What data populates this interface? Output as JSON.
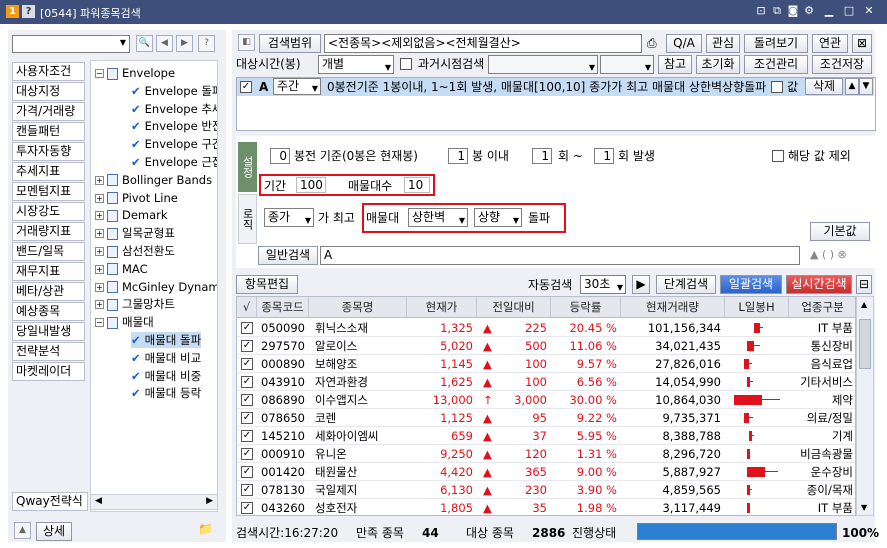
{
  "window": {
    "badge": "1",
    "help": "?",
    "title": "[0544] 파워종목검색"
  },
  "sidebar": {
    "categories": [
      "사용자조건",
      "대상지정",
      "가격/거래량",
      "캔들패턴",
      "투자자동향",
      "추세지표",
      "모멘텀지표",
      "시장강도",
      "거래량지표",
      "밴드/일목",
      "재무지표",
      "베타/상관",
      "예상종목",
      "당일내발생",
      "전략분석",
      "마켓레이더"
    ],
    "qway": "Qway전략식",
    "detail_btn": "상세"
  },
  "tree": [
    {
      "t": "Envelope",
      "type": "folder",
      "open": true
    },
    {
      "t": "Envelope 돌파",
      "type": "item"
    },
    {
      "t": "Envelope 추세",
      "type": "item"
    },
    {
      "t": "Envelope 반전",
      "type": "item"
    },
    {
      "t": "Envelope 구간",
      "type": "item"
    },
    {
      "t": "Envelope 근접",
      "type": "item"
    },
    {
      "t": "Bollinger Bands",
      "type": "folder",
      "open": false
    },
    {
      "t": "Pivot Line",
      "type": "folder",
      "open": false
    },
    {
      "t": "Demark",
      "type": "folder",
      "open": false
    },
    {
      "t": "일목균형표",
      "type": "folder",
      "open": false
    },
    {
      "t": "삼선전환도",
      "type": "folder",
      "open": false
    },
    {
      "t": "MAC",
      "type": "folder",
      "open": false
    },
    {
      "t": "McGinley Dynamic",
      "type": "folder",
      "open": false
    },
    {
      "t": "그물망차트",
      "type": "folder",
      "open": false
    },
    {
      "t": "매물대",
      "type": "folder",
      "open": true
    },
    {
      "t": "매물대 돌파",
      "type": "item",
      "selected": true
    },
    {
      "t": "매물대 비교",
      "type": "item"
    },
    {
      "t": "매물대 비중",
      "type": "item"
    },
    {
      "t": "매물대 등락",
      "type": "item"
    }
  ],
  "top": {
    "range_btn": "검색범위",
    "range_text": "<전종목><제외없음><전체월결산>",
    "qa": "Q/A",
    "fav": "관심",
    "replay": "돌려보기",
    "link": "연관",
    "target_label": "대상시간(봉)",
    "target_value": "개별",
    "past_label": "과거시점검색",
    "ref": "참고",
    "reset": "초기화",
    "manage": "조건관리",
    "save": "조건저장"
  },
  "cond_row": {
    "letter": "A",
    "period": "주간",
    "text": "0봉전기준 1봉이내, 1~1회 발생, 매물대[100,10] 종가가 최고 매물대 상한벽상향돌파",
    "value_label": "값",
    "delete": "삭제"
  },
  "setting": {
    "tab1": "설정",
    "tab2": "로직",
    "bong_value": "0",
    "bong_label": "봉전 기준(0봉은 현재봉)",
    "within_value": "1",
    "within_label": "봉 이내",
    "times_from": "1",
    "times_mid": "회 ~",
    "times_to": "1",
    "times_label": "회 발생",
    "exclude_label": "해당 값 제외",
    "period_label": "기간",
    "period_value": "100",
    "count_label": "매물대수",
    "count_value": "10",
    "price_sel": "종가",
    "max_label": "가 최고",
    "mulmul_label": "매물대",
    "wall_sel": "상한벽",
    "dir_sel": "상향",
    "breakout": "돌파",
    "default_btn": "기본값",
    "general_btn": "일반검색",
    "general_text": "A"
  },
  "toolbar": {
    "edit": "항목편집",
    "auto_label": "자동검색",
    "auto_value": "30초",
    "step": "단계검색",
    "bulk": "일괄검색",
    "realtime": "실시간검색"
  },
  "columns": [
    "√",
    "종목코드",
    "종목명",
    "현재가",
    "전일대비",
    "등락률",
    "현재거래량",
    "L일봉H",
    "업종구분"
  ],
  "rows": [
    {
      "code": "050090",
      "name": "휘닉스소재",
      "price": "1,325",
      "arrow": "▲",
      "chg": "225",
      "rate": "20.45 %",
      "vol": "101,156,344",
      "bar": [
        0.45,
        0.62
      ],
      "sector": "IT 부품"
    },
    {
      "code": "297570",
      "name": "알로이스",
      "price": "5,020",
      "arrow": "▲",
      "chg": "500",
      "rate": "11.06 %",
      "vol": "34,021,435",
      "bar": [
        0.3,
        0.55
      ],
      "sector": "통신장비"
    },
    {
      "code": "000890",
      "name": "보해양조",
      "price": "1,145",
      "arrow": "▲",
      "chg": "100",
      "rate": "9.57 %",
      "vol": "27,826,016",
      "bar": [
        0.25,
        0.4
      ],
      "sector": "음식료업"
    },
    {
      "code": "043910",
      "name": "자연과환경",
      "price": "1,625",
      "arrow": "▲",
      "chg": "100",
      "rate": "6.56 %",
      "vol": "14,054,990",
      "bar": [
        0.3,
        0.42
      ],
      "sector": "기타서비스"
    },
    {
      "code": "086890",
      "name": "이수앱지스",
      "price": "13,000",
      "arrow": "↑",
      "chg": "3,000",
      "rate": "30.00 %",
      "vol": "10,864,030",
      "bar": [
        0.05,
        0.95
      ],
      "sector": "제약"
    },
    {
      "code": "078650",
      "name": "코렌",
      "price": "1,125",
      "arrow": "▲",
      "chg": "95",
      "rate": "9.22 %",
      "vol": "9,735,371",
      "bar": [
        0.25,
        0.42
      ],
      "sector": "의료/정밀"
    },
    {
      "code": "145210",
      "name": "세화아이엠씨",
      "price": "659",
      "arrow": "▲",
      "chg": "37",
      "rate": "5.95 %",
      "vol": "8,388,788",
      "bar": [
        0.35,
        0.45
      ],
      "sector": "기계"
    },
    {
      "code": "000910",
      "name": "유니온",
      "price": "9,250",
      "arrow": "▲",
      "chg": "120",
      "rate": "1.31 %",
      "vol": "8,296,720",
      "bar": [
        0.3,
        0.35
      ],
      "sector": "비금속광물"
    },
    {
      "code": "001420",
      "name": "태원물산",
      "price": "4,420",
      "arrow": "▲",
      "chg": "365",
      "rate": "9.00 %",
      "vol": "5,887,927",
      "bar": [
        0.3,
        0.9
      ],
      "sector": "운수장비"
    },
    {
      "code": "078130",
      "name": "국일제지",
      "price": "6,130",
      "arrow": "▲",
      "chg": "230",
      "rate": "3.90 %",
      "vol": "4,859,565",
      "bar": [
        0.3,
        0.4
      ],
      "sector": "종이/목재"
    },
    {
      "code": "043260",
      "name": "성호전자",
      "price": "1,805",
      "arrow": "▲",
      "chg": "35",
      "rate": "1.98 %",
      "vol": "3,117,449",
      "bar": [
        0.3,
        0.35
      ],
      "sector": "IT 부품"
    }
  ],
  "status": {
    "time_label": "검색시간:16:27:20",
    "match_label": "만족 종목",
    "match_value": "44",
    "target_label": "대상 종목",
    "target_value": "2886",
    "progress_label": "진행상태",
    "progress": 1.0,
    "percent": "100%"
  }
}
